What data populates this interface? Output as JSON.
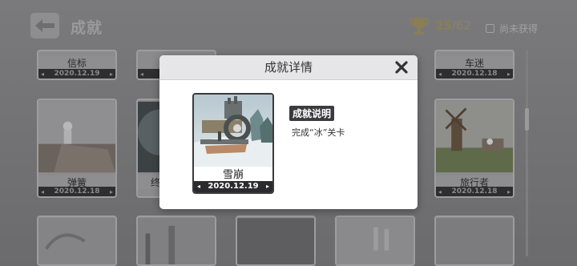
{
  "header": {
    "title": "成就",
    "unlocked": "25",
    "total": "/62",
    "filter_label": "尚未获得"
  },
  "cards": [
    {
      "name": "信标",
      "date": "2020.12.19"
    },
    {
      "name": "",
      "date": ""
    },
    {
      "name": "车迷",
      "date": "2020.12.18"
    },
    {
      "name": "弹簧",
      "date": "2020.12.18"
    },
    {
      "name": "终",
      "date": ""
    },
    {
      "name": "旅行者",
      "date": "2020.12.18"
    }
  ],
  "modal": {
    "title": "成就详情",
    "achievement_name": "雪崩",
    "achievement_date": "2020.12.19",
    "description_tag": "成就说明",
    "description": "完成“冰”关卡"
  },
  "colors": {
    "background": "#6e6e70",
    "modal_header": "#e6e6e8",
    "date_bar": "#2b2b2d",
    "trophy": "#8a7e55"
  }
}
